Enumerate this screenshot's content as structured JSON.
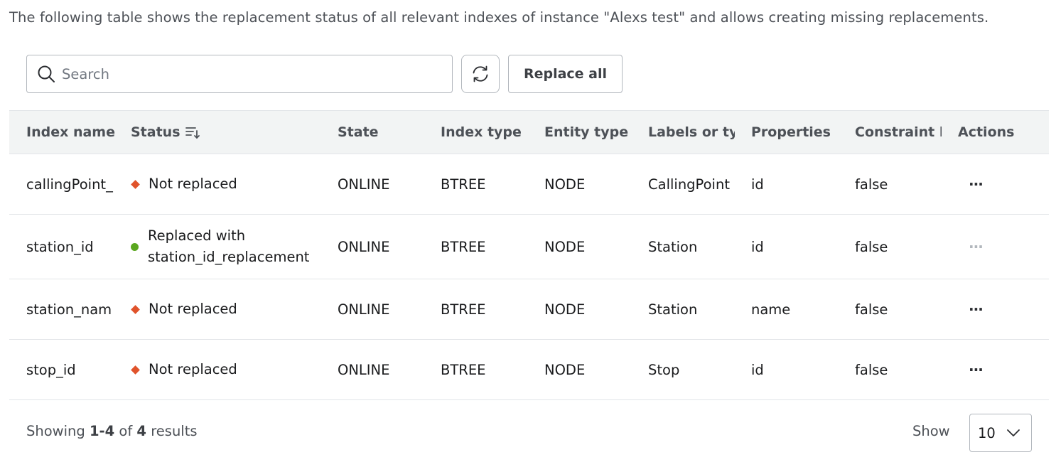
{
  "intro_text": "The following table shows the replacement status of all relevant indexes of instance \"Alexs test\" and allows creating missing replacements.",
  "toolbar": {
    "search_placeholder": "Search",
    "search_value": "",
    "search_icon": "search-icon",
    "refresh_icon": "refresh-icon",
    "replace_all_label": "Replace all"
  },
  "columns": [
    "Index name",
    "Status",
    "State",
    "Index type",
    "Entity type",
    "Labels or typ",
    "Properties",
    "Constraint b",
    "Actions"
  ],
  "sort_icon": "sort-descending-icon",
  "status_colors": {
    "not_replaced": "#e0532b",
    "replaced": "#5aa71f"
  },
  "rows": [
    {
      "index_name": "callingPoint_",
      "status": "Not replaced",
      "state": "ONLINE",
      "index_type": "BTREE",
      "entity_type": "NODE",
      "labels": "CallingPoint",
      "properties": "id",
      "constraint": "false",
      "actions": "···",
      "actions_disabled": false
    },
    {
      "index_name": "station_id",
      "status": "Replaced with station_id_replacement",
      "state": "ONLINE",
      "index_type": "BTREE",
      "entity_type": "NODE",
      "labels": "Station",
      "properties": "id",
      "constraint": "false",
      "actions": "···",
      "actions_disabled": true
    },
    {
      "index_name": "station_nam",
      "status": "Not replaced",
      "state": "ONLINE",
      "index_type": "BTREE",
      "entity_type": "NODE",
      "labels": "Station",
      "properties": "name",
      "constraint": "false",
      "actions": "···",
      "actions_disabled": false
    },
    {
      "index_name": "stop_id",
      "status": "Not replaced",
      "state": "ONLINE",
      "index_type": "BTREE",
      "entity_type": "NODE",
      "labels": "Stop",
      "properties": "id",
      "constraint": "false",
      "actions": "···",
      "actions_disabled": false
    }
  ],
  "footer": {
    "showing_prefix": "Showing",
    "showing_range": "1-4",
    "showing_of": "of",
    "showing_total": "4",
    "showing_suffix": "results",
    "show_label": "Show",
    "page_size": "10",
    "chevron_icon": "chevron-down-icon"
  }
}
